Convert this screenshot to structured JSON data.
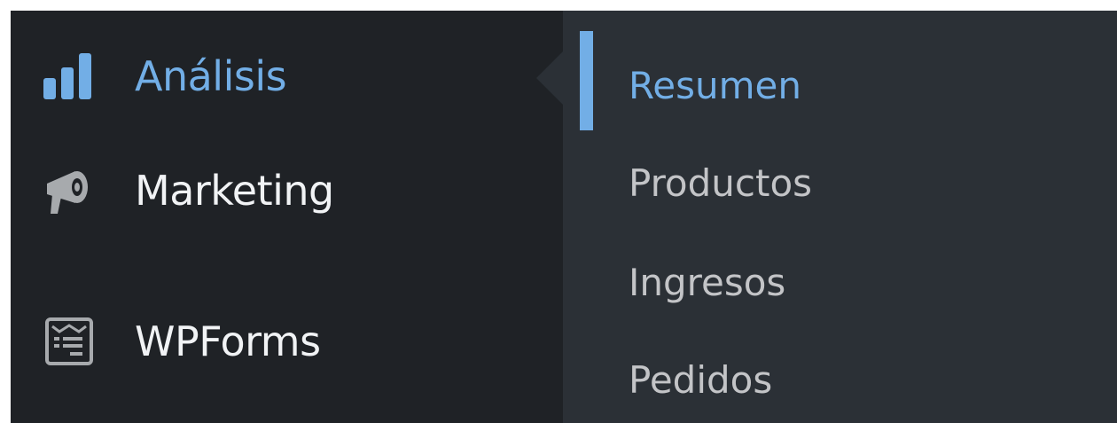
{
  "colors": {
    "sidebar_bg": "#1f2226",
    "submenu_bg": "#2b3036",
    "accent": "#72aee6",
    "text": "#f1f3f5",
    "submenu_text": "#c3c4c7"
  },
  "sidebar": {
    "items": [
      {
        "label": "Análisis",
        "icon": "bar-chart-icon",
        "active": true
      },
      {
        "label": "Marketing",
        "icon": "megaphone-icon",
        "active": false
      },
      {
        "label": "WPForms",
        "icon": "form-icon",
        "active": false
      }
    ]
  },
  "submenu": {
    "items": [
      {
        "label": "Resumen",
        "current": true
      },
      {
        "label": "Productos",
        "current": false
      },
      {
        "label": "Ingresos",
        "current": false
      },
      {
        "label": "Pedidos",
        "current": false
      }
    ]
  }
}
